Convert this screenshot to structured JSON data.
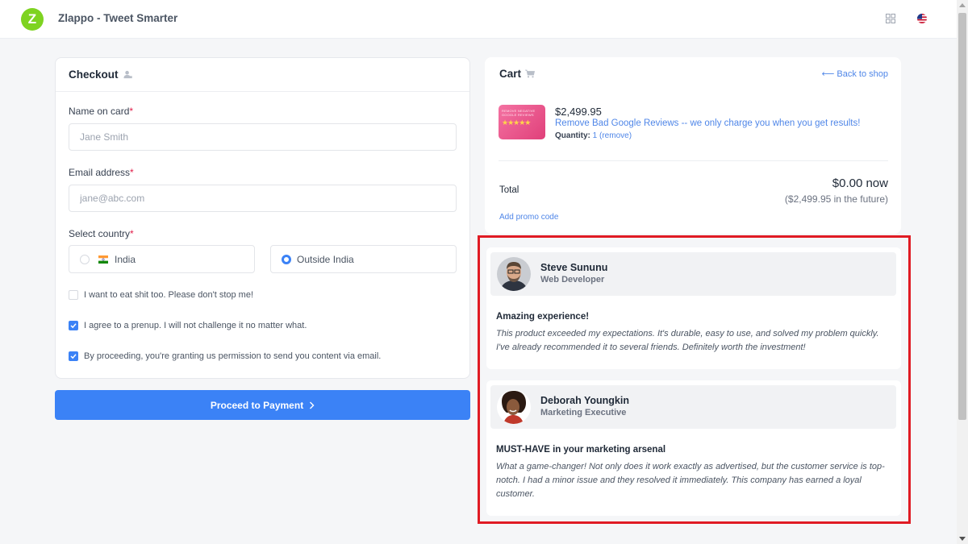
{
  "app": {
    "title": "Zlappo - Tweet Smarter",
    "logo_letter": "Z"
  },
  "header_icons": [
    "grid-icon",
    "us-flag-icon"
  ],
  "checkout": {
    "title": "Checkout",
    "name_label": "Name on card",
    "name_placeholder": "Jane Smith",
    "email_label": "Email address",
    "email_placeholder": "jane@abc.com",
    "country_label": "Select country",
    "required_mark": "*",
    "country_options": [
      {
        "label": "India",
        "selected": false
      },
      {
        "label": "Outside India",
        "selected": true
      }
    ],
    "checkboxes": [
      {
        "label": "I want to eat shit too. Please don't stop me!",
        "checked": false
      },
      {
        "label": "I agree to a prenup. I will not challenge it no matter what.",
        "checked": true
      },
      {
        "label": "By proceeding, you're granting us permission to send you content via email.",
        "checked": true
      }
    ],
    "proceed_label": "Proceed to Payment"
  },
  "cart": {
    "title": "Cart",
    "back_link": "⟵ Back to shop",
    "product": {
      "thumb_text": "REMOVE NEGATIVE GOOGLE REVIEWS",
      "thumb_stars": "★★★★★",
      "price": "$2,499.95",
      "name": "Remove Bad Google Reviews -- we only charge you when you get results!",
      "quantity_label": "Quantity:",
      "quantity": "1",
      "remove_label": "(remove)"
    },
    "total_label": "Total",
    "total_now": "$0.00 now",
    "total_future": "($2,499.95 in the future)",
    "promo_label": "Add promo code"
  },
  "reviews": [
    {
      "name": "Steve Sununu",
      "role": "Web Developer",
      "title": "Amazing experience!",
      "body": "This product exceeded my expectations. It's durable, easy to use, and solved my problem quickly. I've already recommended it to several friends. Definitely worth the investment!"
    },
    {
      "name": "Deborah Youngkin",
      "role": "Marketing Executive",
      "title": "MUST-HAVE in your marketing arsenal",
      "body": "What a game-changer! Not only does it work exactly as advertised, but the customer service is top-notch. I had a minor issue and they resolved it immediately. This company has earned a loyal customer."
    }
  ],
  "colors": {
    "accent": "#3b82f6",
    "link": "#4f86e8",
    "logo": "#7ed321",
    "highlight": "#e01b24"
  }
}
